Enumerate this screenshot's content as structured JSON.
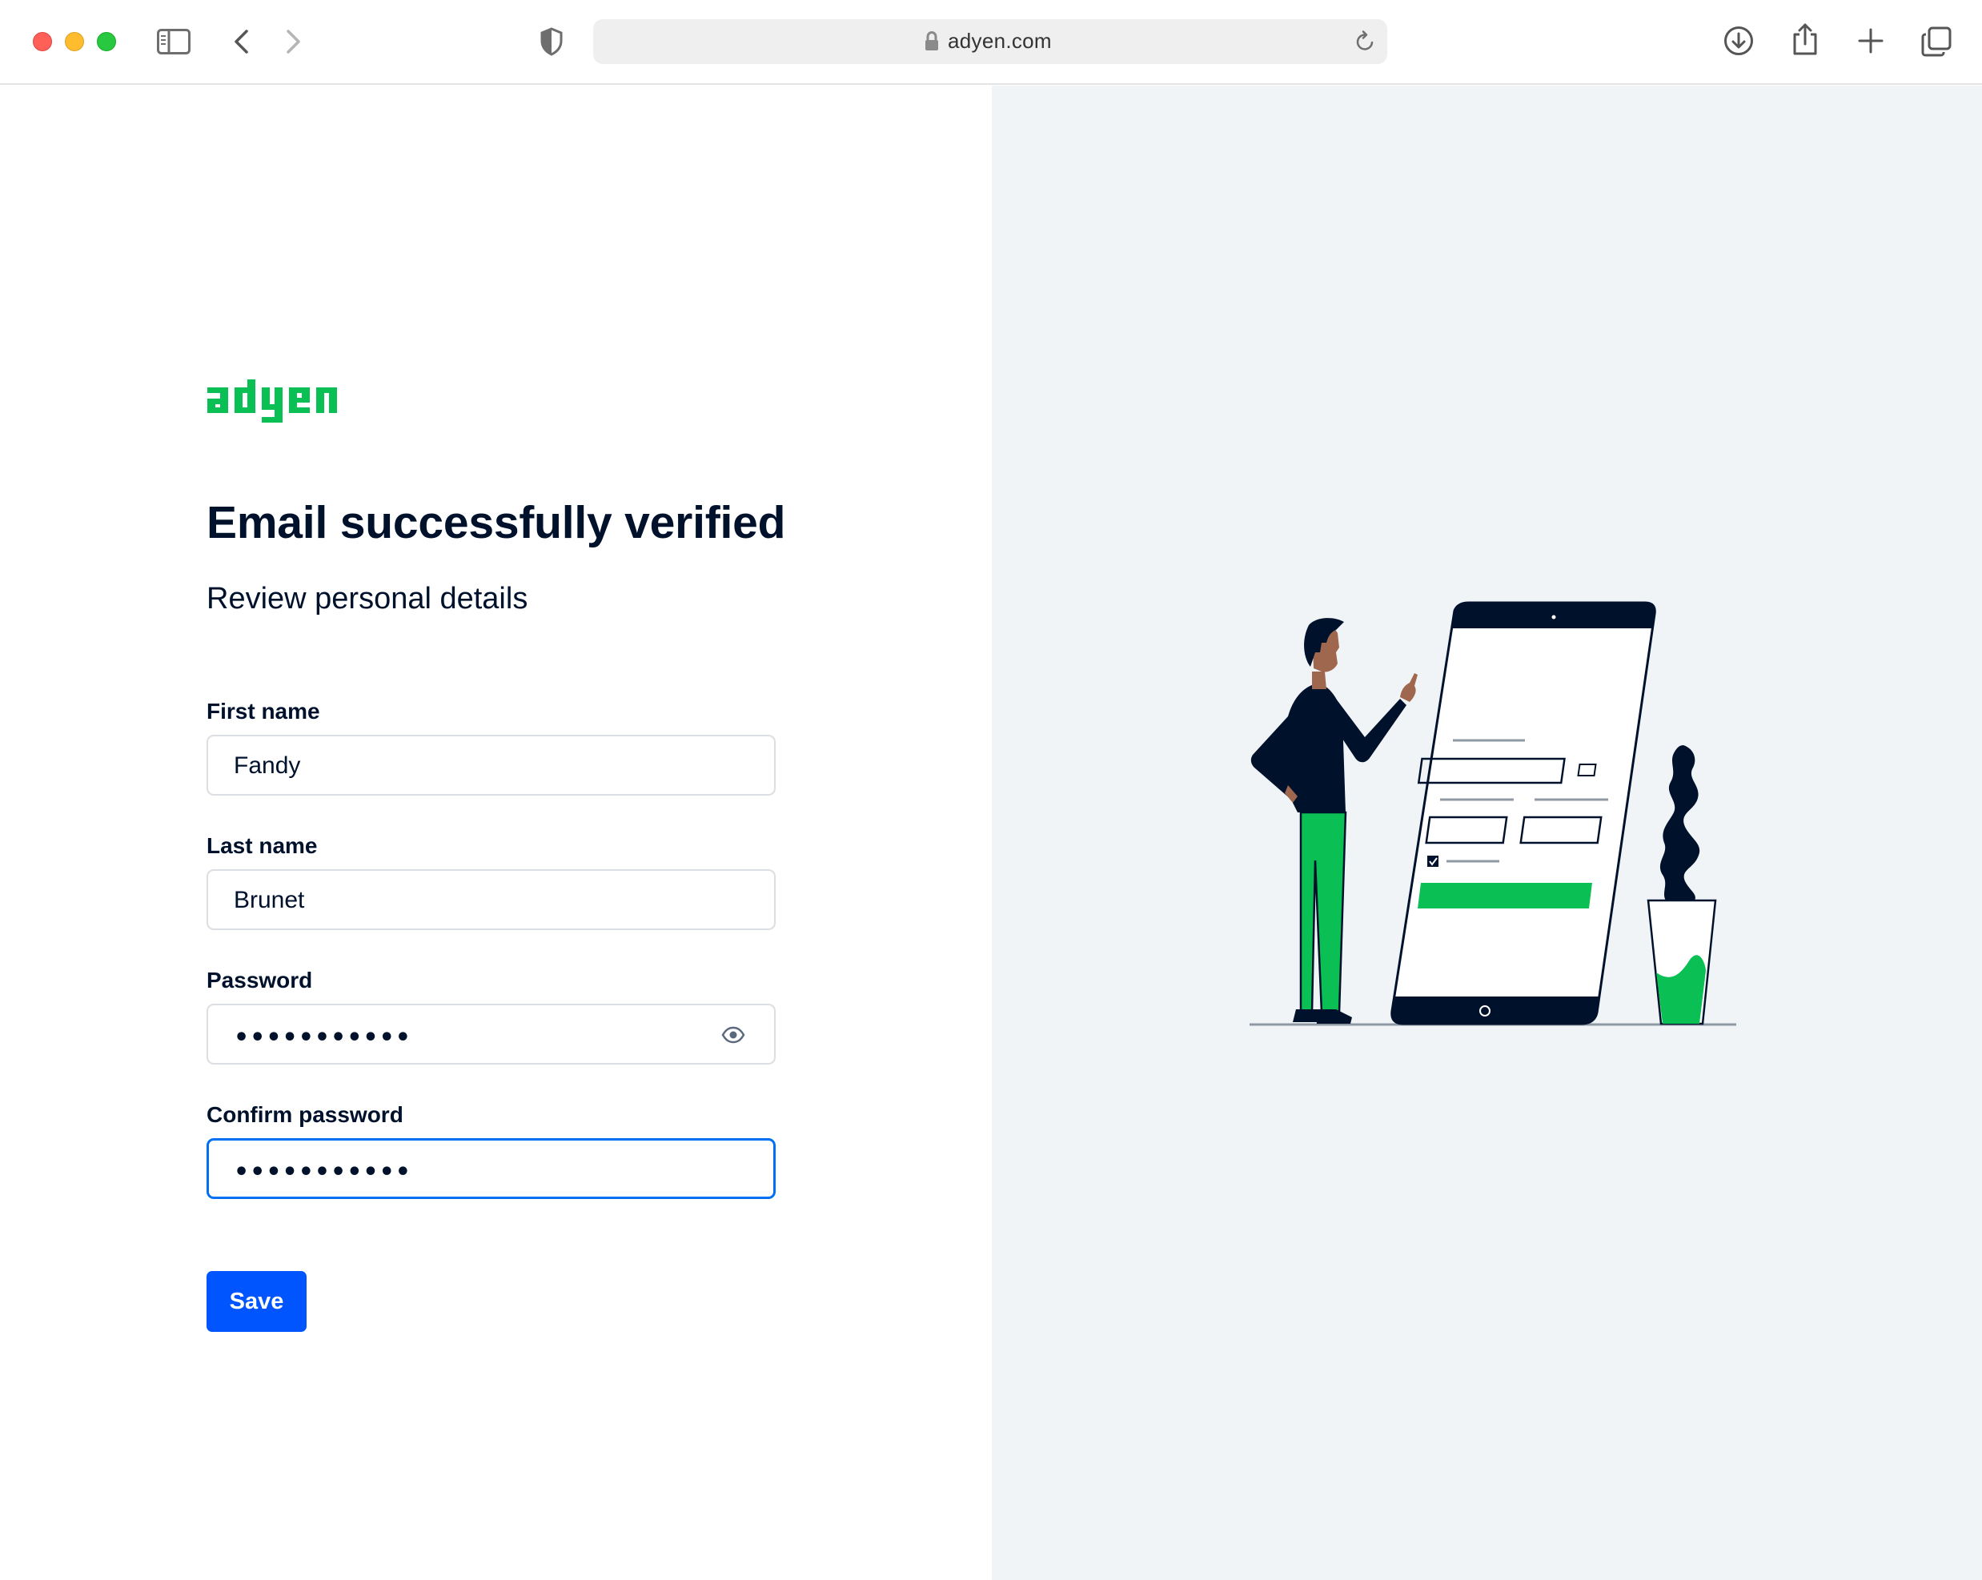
{
  "browser": {
    "url": "adyen.com",
    "icons": [
      "sidebar-icon",
      "back-icon",
      "forward-icon",
      "shield-icon",
      "lock-icon",
      "reload-icon",
      "download-icon",
      "share-icon",
      "new-tab-icon",
      "tab-overview-icon"
    ]
  },
  "brand": {
    "logo_text": "adyen",
    "accent_color": "#0abf53"
  },
  "page": {
    "title": "Email successfully verified",
    "subtitle": "Review personal details"
  },
  "form": {
    "first_name": {
      "label": "First name",
      "value": "Fandy"
    },
    "last_name": {
      "label": "Last name",
      "value": "Brunet"
    },
    "password": {
      "label": "Password",
      "masked": "•••••••••••"
    },
    "confirm_password": {
      "label": "Confirm password",
      "masked": "•••••••••••"
    },
    "save_label": "Save",
    "primary_color": "#0055ff"
  }
}
